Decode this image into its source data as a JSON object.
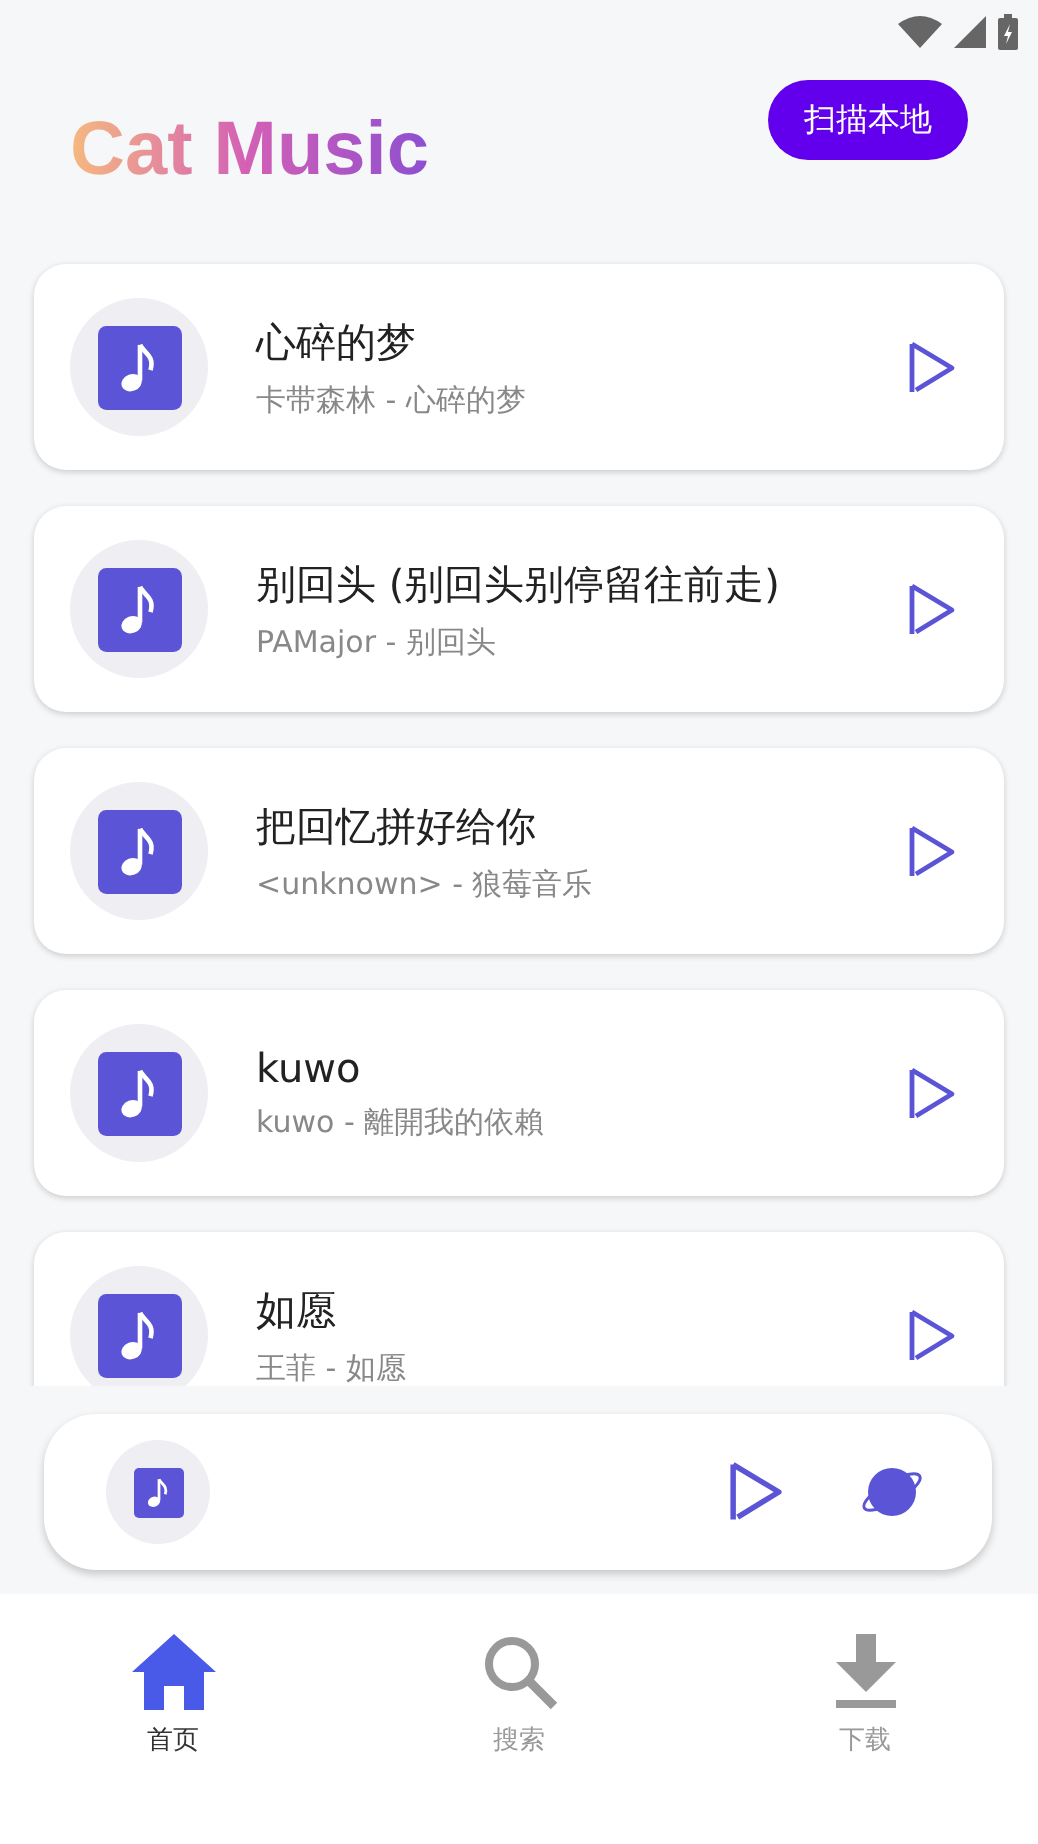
{
  "header": {
    "title": "Cat Music",
    "scan_button": "扫描本地"
  },
  "songs": [
    {
      "title": "心碎的梦",
      "subtitle": "卡带森林 - 心碎的梦"
    },
    {
      "title": "别回头 (别回头别停留往前走)",
      "subtitle": "PAMajor - 别回头"
    },
    {
      "title": "把回忆拼好给你",
      "subtitle": "<unknown> - 狼莓音乐"
    },
    {
      "title": "kuwo",
      "subtitle": "kuwo - 離開我的依賴"
    },
    {
      "title": "如愿",
      "subtitle": "王菲 - 如愿"
    }
  ],
  "nav": [
    {
      "label": "首页",
      "kind": "home",
      "selected": true
    },
    {
      "label": "搜索",
      "kind": "search",
      "selected": false
    },
    {
      "label": "下载",
      "kind": "download",
      "selected": false
    }
  ]
}
